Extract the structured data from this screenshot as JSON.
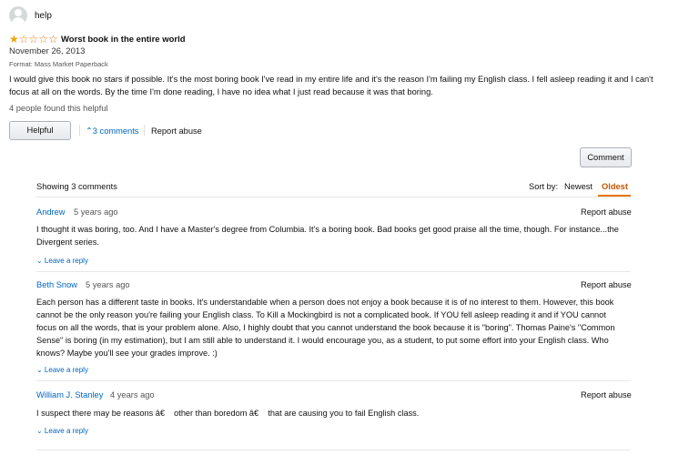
{
  "review": {
    "username": "help",
    "rating": 1,
    "rating_max": 5,
    "title": "Worst book in the entire world",
    "date": "November 26, 2013",
    "format": "Format: Mass Market Paperback",
    "body": "I would give this book no stars if possible. It's the most boring book I've read in my entire life and it's the reason I'm failing my English class. I fell asleep reading it and I can't focus at all on the words. By the time I'm done reading, I have no idea what I just read because it was that boring.",
    "helpful_count_text": "4 people found this helpful",
    "helpful_button": "Helpful",
    "comments_link": "⌃3 comments",
    "report_abuse": "Report abuse"
  },
  "comments_section": {
    "comment_button": "Comment",
    "showing": "Showing 3 comments",
    "sort_label": "Sort by:",
    "sort_newest": "Newest",
    "sort_oldest": "Oldest",
    "comments": [
      {
        "author": "Andrew",
        "ago": "5 years ago",
        "report": "Report abuse",
        "text": "I thought it was boring, too. And I have a Master's degree from Columbia. It's a boring book. Bad books get good praise all the time, though. For instance...the Divergent series.",
        "reply": "⌄ Leave a reply"
      },
      {
        "author": "Beth Snow",
        "ago": "5 years ago",
        "report": "Report abuse",
        "text": "Each person has a different taste in books. It's understandable when a person does not enjoy a book because it is of no interest to them. However, this book cannot be the only reason you're failing your English class. To Kill a Mockingbird is not a complicated book. If YOU fell asleep reading it and if YOU cannot focus on all the words, that is your problem alone. Also, I highly doubt that you cannot understand the book because it is \"boring\". Thomas Paine's \"Common Sense\" is boring (in my estimation), but I am still able to understand it. I would encourage you, as a student, to put some effort into your English class. Who knows? Maybe you'll see your grades improve. :)",
        "reply": "⌄ Leave a reply"
      },
      {
        "author": "William J. Stanley",
        "ago": "4 years ago",
        "report": "Report abuse",
        "text": "I suspect there may be reasons â€    other than boredom â€    that are causing you to fail English class.",
        "reply": "⌄ Leave a reply"
      }
    ]
  }
}
